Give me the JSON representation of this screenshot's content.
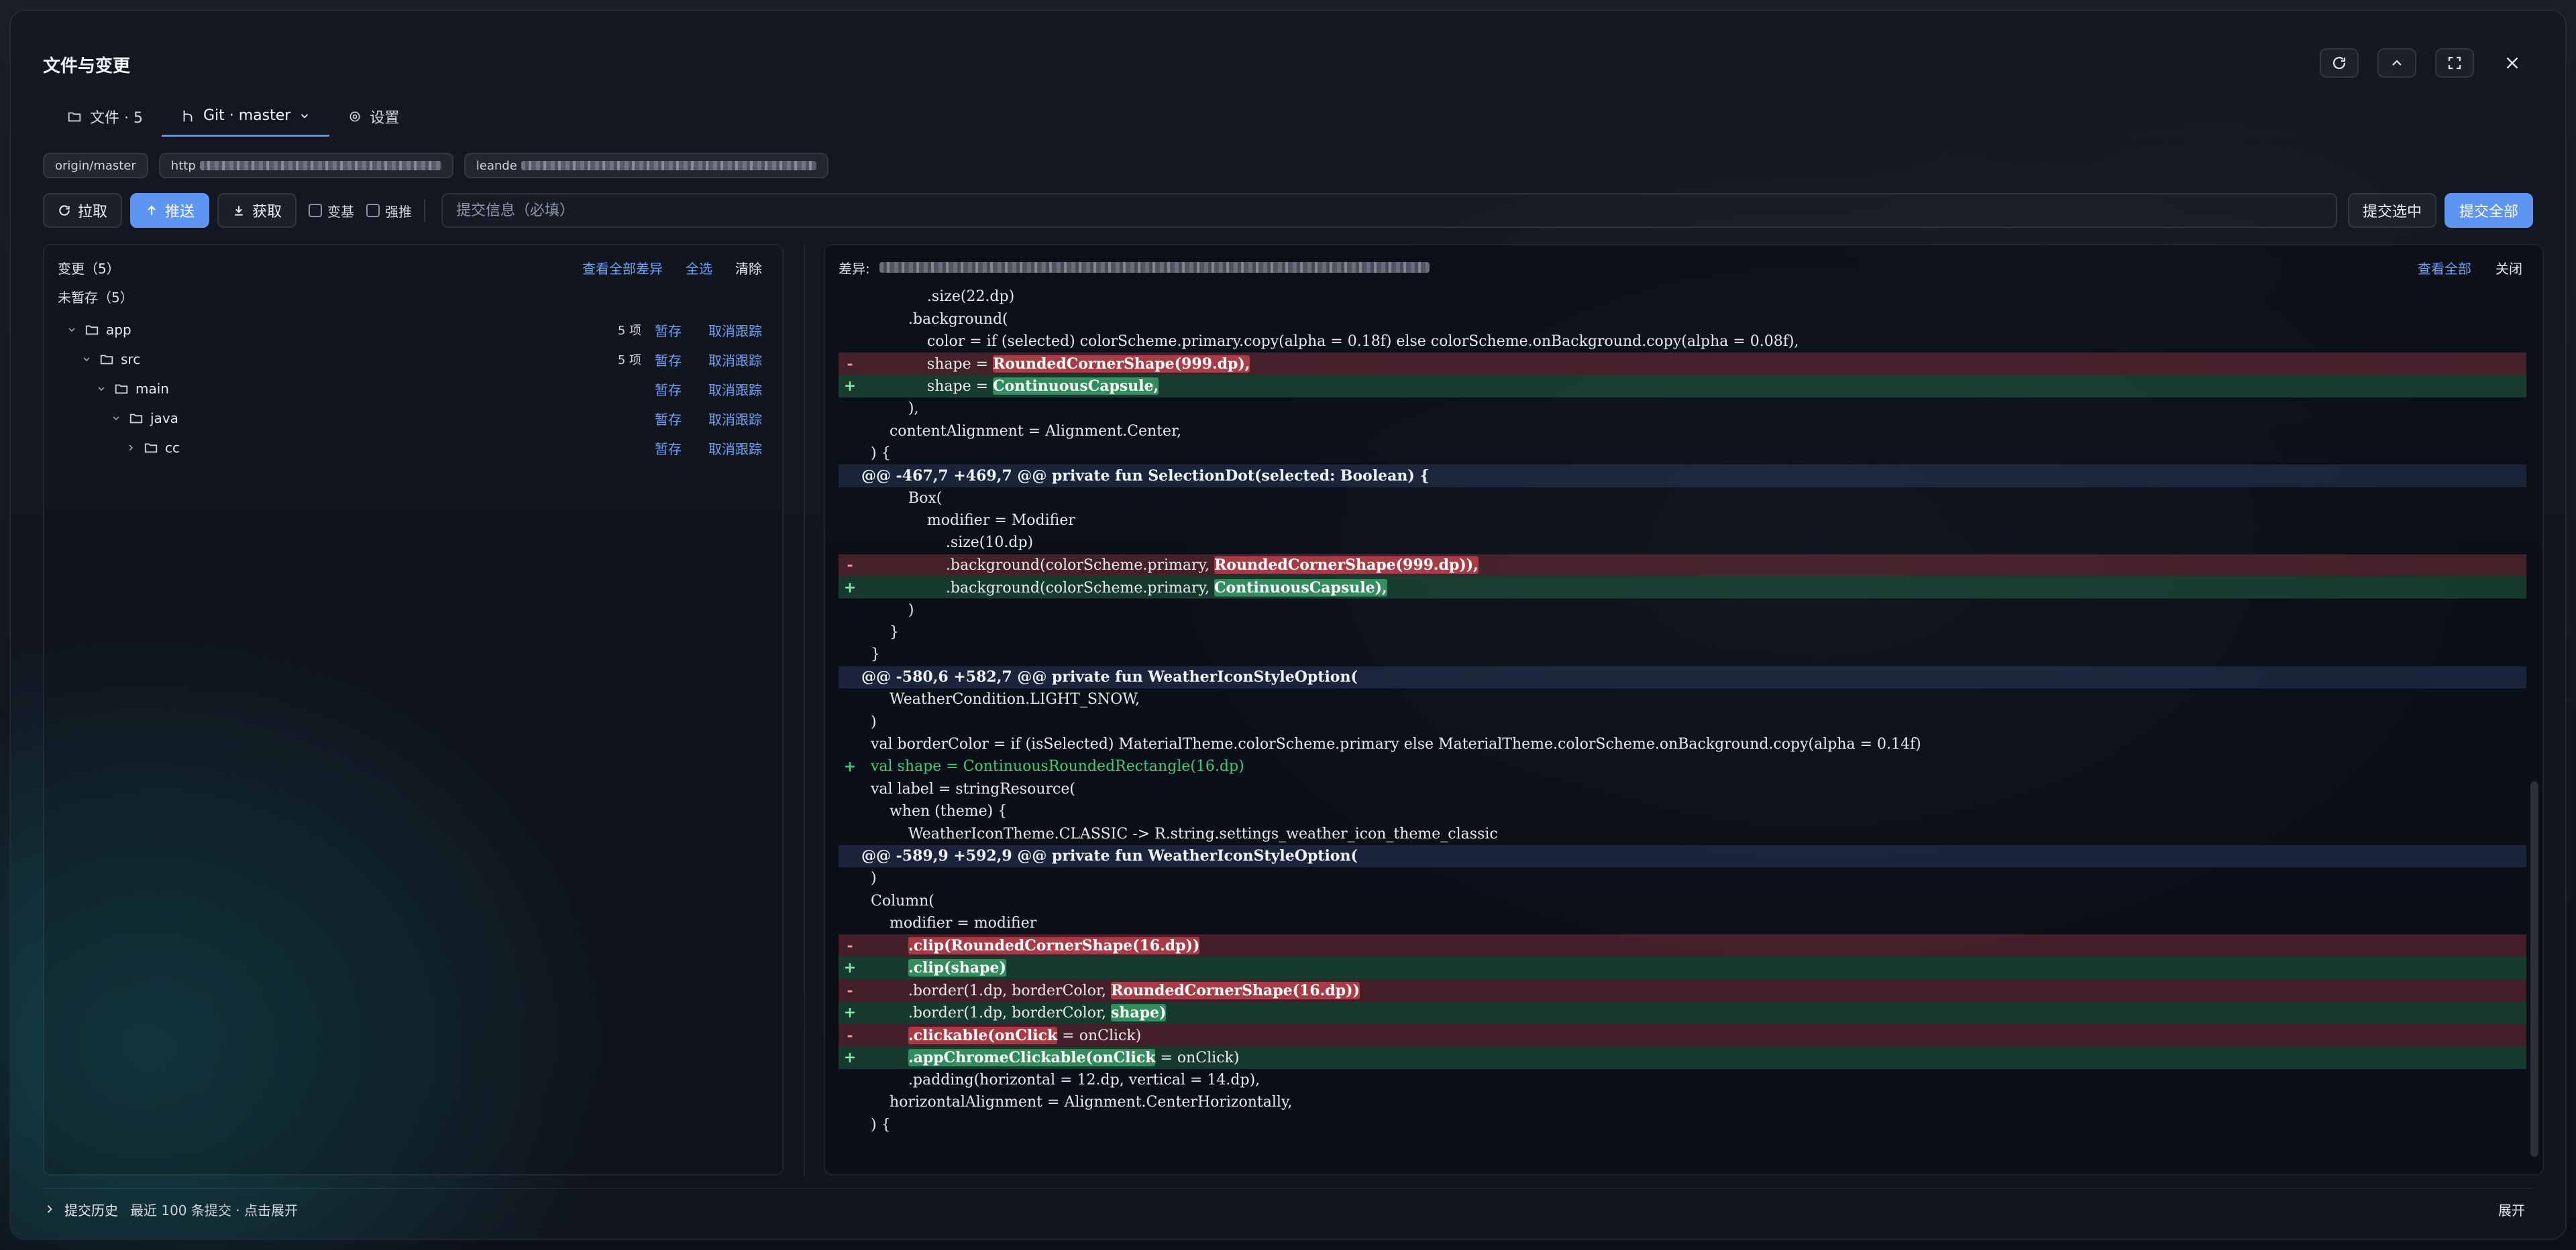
{
  "window": {
    "title": "文件与变更"
  },
  "tabs": [
    {
      "label": "文件 · 5",
      "icon": "folder-icon"
    },
    {
      "label": "Git · master",
      "icon": "git-branch-icon"
    },
    {
      "label": "设置",
      "icon": "gear-icon"
    }
  ],
  "pills": {
    "remote_branch": "origin/master",
    "url_prefix": "http",
    "user_prefix": "leande"
  },
  "toolbar": {
    "pull": "拉取",
    "push": "推送",
    "fetch": "获取",
    "rebase": "变基",
    "force": "强推",
    "commit_placeholder": "提交信息（必填）",
    "commit_selected": "提交选中",
    "commit_all": "提交全部"
  },
  "changes": {
    "header": "变更（5）",
    "view_all_diff": "查看全部差异",
    "select_all": "全选",
    "clear": "清除",
    "unstaged_label": "未暂存（5）",
    "tree": [
      {
        "name": "app",
        "count": "5 项",
        "stage": "暂存",
        "untrack": "取消跟踪"
      },
      {
        "name": "src",
        "count": "5 项",
        "stage": "暂存",
        "untrack": "取消跟踪"
      },
      {
        "name": "main",
        "count": "",
        "stage": "暂存",
        "untrack": "取消跟踪"
      },
      {
        "name": "java",
        "count": "",
        "stage": "暂存",
        "untrack": "取消跟踪"
      },
      {
        "name": "cc",
        "count": "",
        "stage": "暂存",
        "untrack": "取消跟踪"
      }
    ]
  },
  "diff": {
    "label": "差异:",
    "view_all": "查看全部",
    "close": "关闭",
    "lines": [
      {
        "t": "ctx",
        "c": "              .size(22.dp)"
      },
      {
        "t": "ctx",
        "c": "          .background("
      },
      {
        "t": "ctx",
        "c": "              color = if (selected) colorScheme.primary.copy(alpha = 0.18f) else colorScheme.onBackground.copy(alpha = 0.08f),"
      },
      {
        "t": "del",
        "pre": "              shape = ",
        "hl": "RoundedCornerShape(999.dp),",
        "post": ""
      },
      {
        "t": "add",
        "pre": "              shape = ",
        "hl": "ContinuousCapsule,",
        "post": ""
      },
      {
        "t": "ctx",
        "c": "          ),"
      },
      {
        "t": "ctx",
        "c": "      contentAlignment = Alignment.Center,"
      },
      {
        "t": "ctx",
        "c": "  ) {"
      },
      {
        "t": "hunk",
        "c": "@@ -467,7 +469,7 @@ private fun SelectionDot(selected: Boolean) {"
      },
      {
        "t": "ctx",
        "c": "          Box("
      },
      {
        "t": "ctx",
        "c": "              modifier = Modifier"
      },
      {
        "t": "ctx",
        "c": "                  .size(10.dp)"
      },
      {
        "t": "del",
        "pre": "                  .background(colorScheme.primary, ",
        "hl": "RoundedCornerShape(999.dp)),",
        "post": ""
      },
      {
        "t": "add",
        "pre": "                  .background(colorScheme.primary, ",
        "hl": "ContinuousCapsule),",
        "post": ""
      },
      {
        "t": "ctx",
        "c": "          )"
      },
      {
        "t": "ctx",
        "c": "      }"
      },
      {
        "t": "ctx",
        "c": "  }"
      },
      {
        "t": "hunk",
        "c": "@@ -580,6 +582,7 @@ private fun WeatherIconStyleOption("
      },
      {
        "t": "ctx",
        "c": "      WeatherCondition.LIGHT_SNOW,"
      },
      {
        "t": "ctx",
        "c": "  )"
      },
      {
        "t": "ctx",
        "c": "  val borderColor = if (isSelected) MaterialTheme.colorScheme.primary else MaterialTheme.colorScheme.onBackground.copy(alpha = 0.14f)"
      },
      {
        "t": "ghost",
        "c": "  val shape = ContinuousRoundedRectangle(16.dp)"
      },
      {
        "t": "ctx",
        "c": "  val label = stringResource("
      },
      {
        "t": "ctx",
        "c": "      when (theme) {"
      },
      {
        "t": "ctx",
        "c": "          WeatherIconTheme.CLASSIC -> R.string.settings_weather_icon_theme_classic"
      },
      {
        "t": "hunk",
        "c": "@@ -589,9 +592,9 @@ private fun WeatherIconStyleOption("
      },
      {
        "t": "ctx",
        "c": "  )"
      },
      {
        "t": "ctx",
        "c": "  Column("
      },
      {
        "t": "ctx",
        "c": "      modifier = modifier"
      },
      {
        "t": "del",
        "pre": "          ",
        "hl": ".clip(RoundedCornerShape(16.dp))",
        "post": ""
      },
      {
        "t": "add",
        "pre": "          ",
        "hl": ".clip(shape)",
        "post": ""
      },
      {
        "t": "del",
        "pre": "          .border(1.dp, borderColor, ",
        "hl": "RoundedCornerShape(16.dp))",
        "post": ""
      },
      {
        "t": "add",
        "pre": "          .border(1.dp, borderColor, ",
        "hl": "shape)",
        "post": ""
      },
      {
        "t": "del",
        "pre": "          ",
        "hl": ".clickable(onClick",
        "post": " = onClick)"
      },
      {
        "t": "add",
        "pre": "          ",
        "hl": ".appChromeClickable(onClick",
        "post": " = onClick)"
      },
      {
        "t": "ctx",
        "c": "          .padding(horizontal = 12.dp, vertical = 14.dp),"
      },
      {
        "t": "ctx",
        "c": "      horizontalAlignment = Alignment.CenterHorizontally,"
      },
      {
        "t": "ctx",
        "c": "  ) {"
      }
    ]
  },
  "history": {
    "title": "提交历史",
    "hint": "最近 100 条提交 · 点击展开",
    "expand": "展开"
  },
  "colors": {
    "accent": "#5f95f2",
    "link": "#6ea0f5",
    "del_bg": "#5a2a33",
    "add_bg": "#1e4a36"
  }
}
